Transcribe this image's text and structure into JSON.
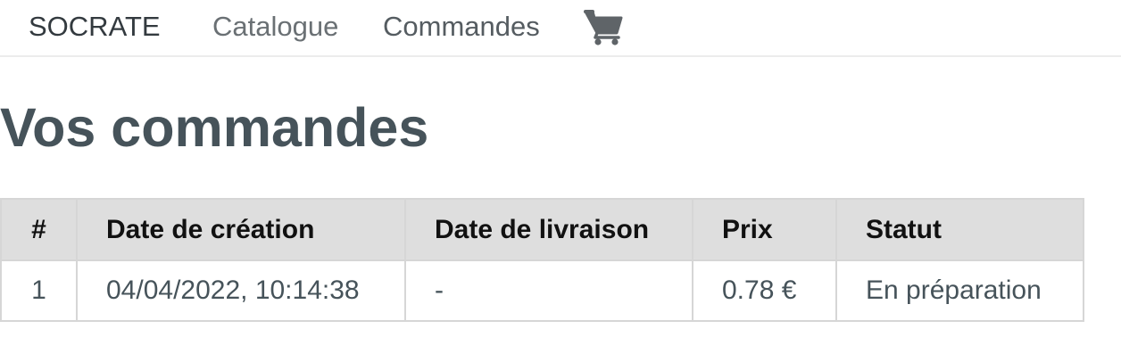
{
  "navbar": {
    "brand": "SOCRATE",
    "links": [
      {
        "label": "Catalogue"
      },
      {
        "label": "Commandes"
      }
    ],
    "cart_icon": "shopping-cart-icon"
  },
  "page": {
    "title": "Vos commandes"
  },
  "orders_table": {
    "columns": [
      "#",
      "Date de création",
      "Date de livraison",
      "Prix",
      "Statut"
    ],
    "rows": [
      {
        "number": "1",
        "created": "04/04/2022, 10:14:38",
        "delivered": "-",
        "price": "0.78 €",
        "status": "En préparation"
      }
    ]
  },
  "colors": {
    "title": "#46535a",
    "header_bg": "#dedede",
    "border": "#d6d6d6"
  }
}
